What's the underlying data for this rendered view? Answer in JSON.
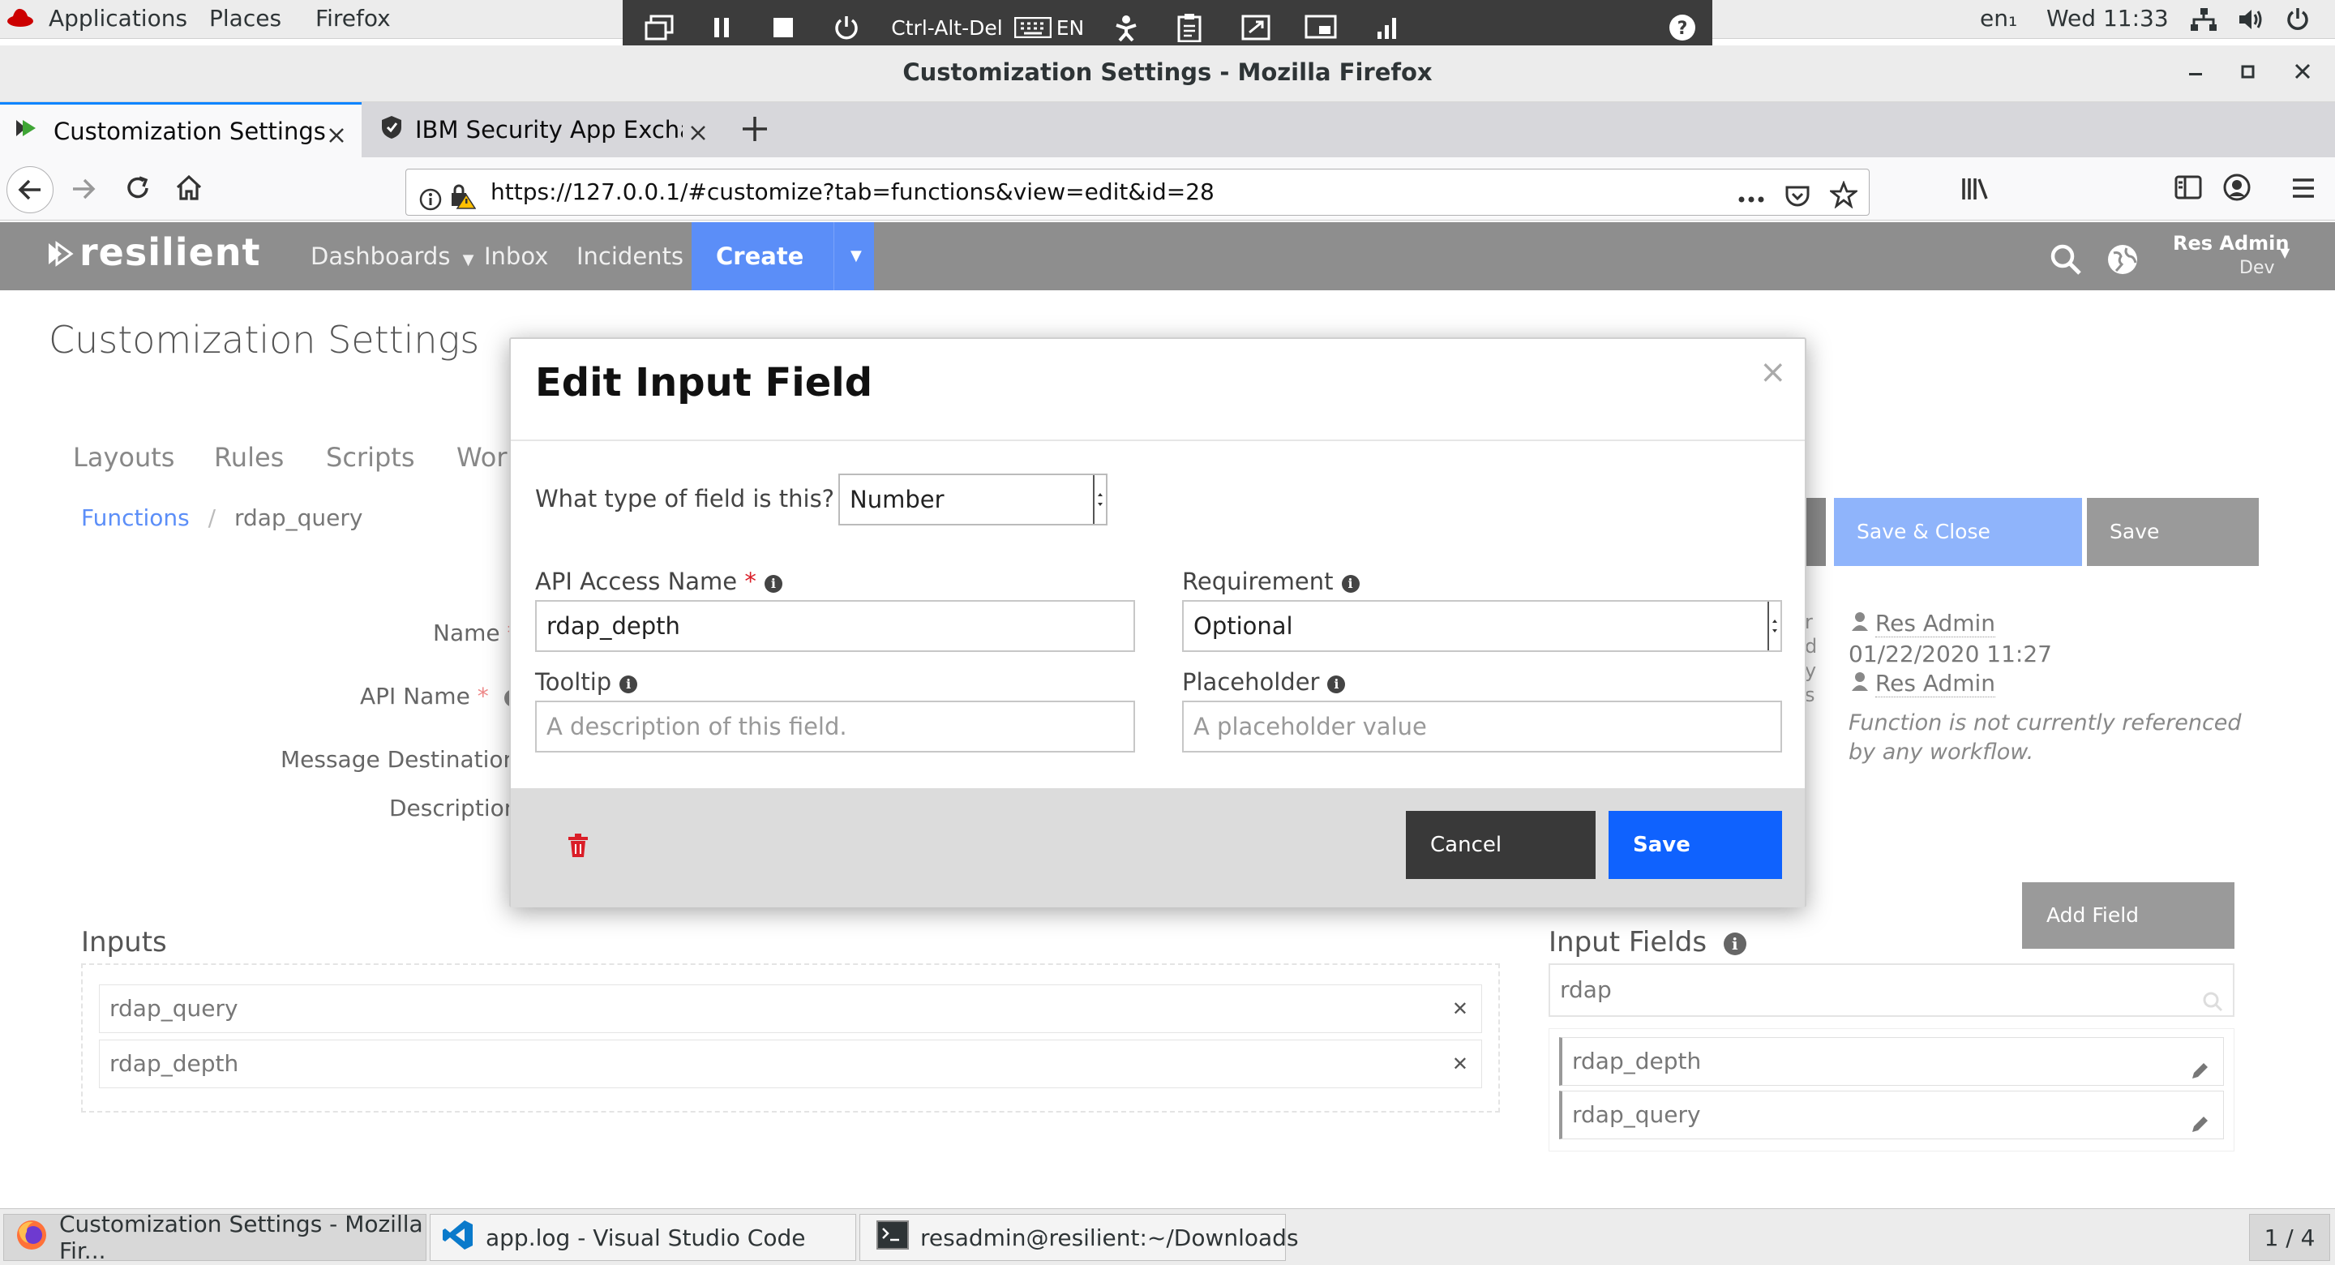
{
  "system_bar": {
    "menus": [
      "Applications",
      "Places",
      "Firefox"
    ],
    "lang": "en₁",
    "clock": "Wed 11:33"
  },
  "vnc_toolbar": {
    "cad_label": "Ctrl-Alt-Del",
    "kbd_label": "EN"
  },
  "window": {
    "title": "Customization Settings - Mozilla Firefox"
  },
  "browser": {
    "tabs": [
      {
        "label": "Customization Settings"
      },
      {
        "label": "IBM Security App Exchang"
      }
    ],
    "url": "https://127.0.0.1/#customize?tab=functions&view=edit&id=28"
  },
  "app_nav": {
    "brand": "resilient",
    "items": [
      "Dashboards",
      "Inbox",
      "Incidents"
    ],
    "create_label": "Create",
    "user_name": "Res Admin",
    "user_org": "Dev"
  },
  "page": {
    "title": "Customization Settings",
    "tabs": [
      "Layouts",
      "Rules",
      "Scripts",
      "Work"
    ],
    "breadcrumb_root": "Functions",
    "breadcrumb_current": "rdap_query",
    "form_labels": [
      "Name",
      "API Name",
      "Message Destination",
      "Description"
    ],
    "save_close_label": "Save & Close",
    "save_label": "Save",
    "meta_creator": "Res Admin",
    "meta_date": "01/22/2020 11:27",
    "meta_modifier": "Res Admin",
    "meta_note": "Function is not currently referenced by any workflow.",
    "add_field_label": "Add Field",
    "inputs_heading": "Inputs",
    "inputs": [
      "rdap_query",
      "rdap_depth"
    ],
    "input_fields_heading": "Input Fields",
    "search_value": "rdap",
    "input_fields": [
      "rdap_depth",
      "rdap_query"
    ]
  },
  "modal": {
    "title": "Edit Input Field",
    "close_symbol": "×",
    "type_label": "What type of field is this?",
    "type_value": "Number",
    "api_label": "API Access Name",
    "api_value": "rdap_depth",
    "requirement_label": "Requirement",
    "requirement_value": "Optional",
    "tooltip_label": "Tooltip",
    "tooltip_placeholder": "A description of this field.",
    "placeholder_label": "Placeholder",
    "placeholder_placeholder": "A placeholder value",
    "cancel_label": "Cancel",
    "save_label": "Save"
  },
  "taskbar": {
    "tasks": [
      "Customization Settings - Mozilla Fir...",
      "app.log - Visual Studio Code",
      "resadmin@resilient:~/Downloads"
    ],
    "workspace": "1 / 4"
  },
  "colors": {
    "accent_blue": "#0f62fe",
    "create_blue": "#5b8ef8",
    "save_close_blue": "#8fb4fb",
    "nav_gray": "#8e8e8e",
    "cancel_dark": "#393939",
    "trash_red": "#da1e28"
  }
}
